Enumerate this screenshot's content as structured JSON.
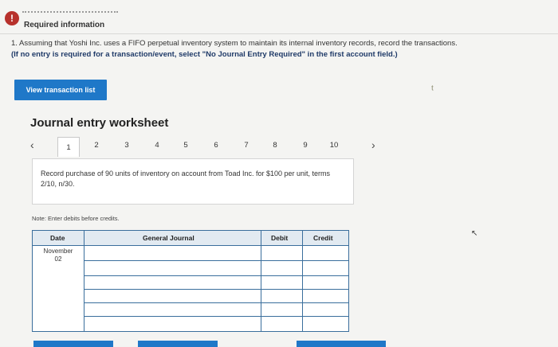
{
  "header": {
    "required_label": "Required information",
    "question_text": "1. Assuming that Yoshi Inc. uses a FIFO perpetual inventory system to maintain its internal inventory records, record the transactions.",
    "question_note": "(If no entry is required for a transaction/event, select \"No Journal Entry Required\" in the first account field.)"
  },
  "buttons": {
    "view_transactions": "View transaction list"
  },
  "worksheet": {
    "title": "Journal entry worksheet",
    "pages": [
      "1",
      "2",
      "3",
      "4",
      "5",
      "6",
      "7",
      "8",
      "9",
      "10"
    ],
    "active_page": "1",
    "transaction_text": "Record purchase of 90 units of inventory on account from Toad Inc. for $100 per unit, terms 2/10, n/30.",
    "note": "Note: Enter debits before credits."
  },
  "journal": {
    "headers": {
      "date": "Date",
      "account": "General Journal",
      "debit": "Debit",
      "credit": "Credit"
    },
    "date_month": "November",
    "date_day": "02"
  },
  "icons": {
    "prev": "chevron-left-icon",
    "next": "chevron-right-icon",
    "info": "info-icon"
  },
  "colors": {
    "accent": "#1f78c8",
    "alert": "#b7312c",
    "table_border": "#3a6e9c"
  }
}
